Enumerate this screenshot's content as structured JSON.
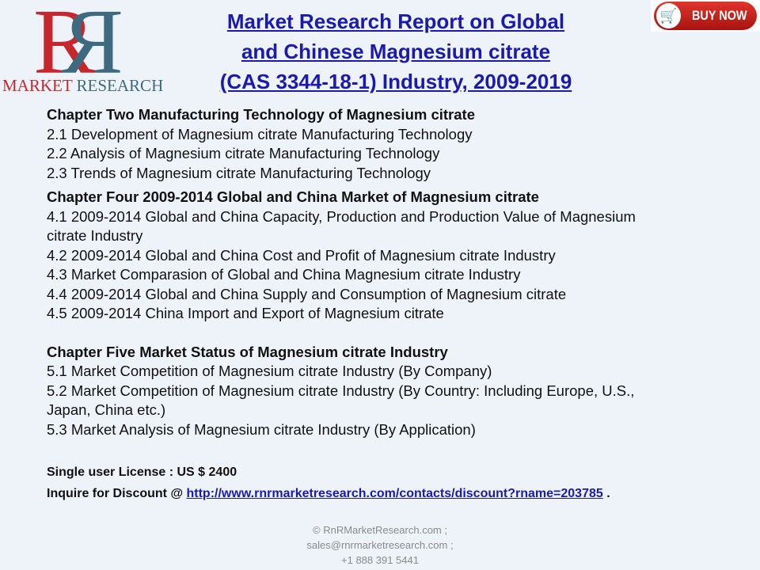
{
  "logo": {
    "letters": "RR",
    "text_a": "MARKET",
    "text_b": " RESEARCH"
  },
  "title": [
    "Market Research Report on Global",
    "and Chinese Magnesium citrate",
    "(CAS 3344-18-1) Industry, 2009-2019"
  ],
  "buy_now": {
    "label": "BUY NOW",
    "icon": "shopping-cart-icon"
  },
  "toc": [
    {
      "type": "h",
      "text": "Chapter Two Manufacturing Technology of Magnesium citrate"
    },
    {
      "type": "i",
      "text": "2.1 Development of Magnesium citrate Manufacturing Technology"
    },
    {
      "type": "i",
      "text": "2.2 Analysis of Magnesium citrate Manufacturing Technology"
    },
    {
      "type": "i",
      "text": "2.3 Trends of Magnesium citrate Manufacturing Technology"
    },
    {
      "type": "h",
      "text": "Chapter Four 2009-2014 Global and China Market of Magnesium citrate"
    },
    {
      "type": "i",
      "text": "4.1 2009-2014 Global and China Capacity, Production and Production Value of Magnesium"
    },
    {
      "type": "i",
      "text": "citrate Industry"
    },
    {
      "type": "i",
      "text": "4.2 2009-2014 Global and China Cost and Profit of Magnesium citrate Industry"
    },
    {
      "type": "i",
      "text": "4.3 Market Comparasion of Global and China Magnesium citrate Industry"
    },
    {
      "type": "i",
      "text": "4.4 2009-2014 Global and China Supply and Consumption of Magnesium citrate"
    },
    {
      "type": "i",
      "text": "4.5 2009-2014 China Import and Export of Magnesium citrate"
    },
    {
      "type": "h",
      "text": "Chapter Five Market Status of Magnesium citrate Industry"
    },
    {
      "type": "i",
      "text": "5.1 Market Competition of Magnesium citrate Industry (By Company)"
    },
    {
      "type": "i",
      "text": "5.2 Market Competition of Magnesium citrate Industry (By Country: Including Europe, U.S.,"
    },
    {
      "type": "i",
      "text": "Japan, China etc.)"
    },
    {
      "type": "i",
      "text": "5.3 Market Analysis of Magnesium citrate Industry (By Application)"
    }
  ],
  "license": {
    "label": "Single user License : US $ 2400",
    "inquire": "Inquire for Discount @ ",
    "url": "http://www.rnrmarketresearch.com/contacts/discount?rname=203785",
    "after": " ."
  },
  "footer": [
    "© RnRMarketResearch.com  ;",
    "sales@rnrmarketresearch.com ;",
    "+1 888 391 5441"
  ]
}
